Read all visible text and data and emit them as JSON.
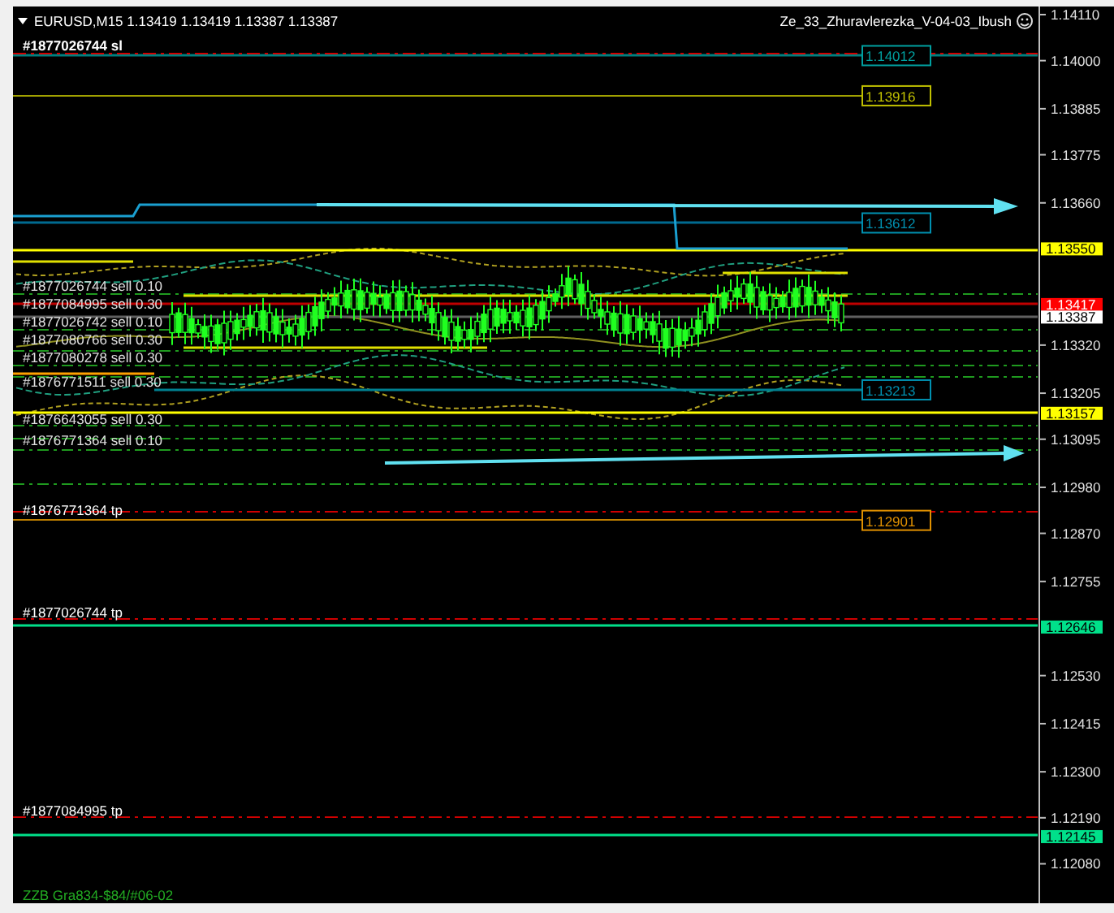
{
  "chart_title": "EURUSD,M15  1.13419 1.13419 1.13387 1.13387",
  "expert_name": "Ze_33_Zhuravlerezka_V-04-03_Ibush",
  "price_axis": {
    "ticks": [
      "1.14110",
      "1.14000",
      "1.13885",
      "1.13775",
      "1.13660",
      "1.13320",
      "1.13205",
      "1.13095",
      "1.12980",
      "1.12870",
      "1.12755",
      "1.12530",
      "1.12415",
      "1.12300",
      "1.12190",
      "1.12080"
    ]
  },
  "axis_tags": [
    {
      "price": "1.13550",
      "color": "#ffff00"
    },
    {
      "price": "1.13417",
      "color": "#ff0000"
    },
    {
      "price": "1.13387",
      "color": "#ffffff"
    },
    {
      "price": "1.13157",
      "color": "#ffff00"
    },
    {
      "price": "1.12646",
      "color": "#00e08a"
    },
    {
      "price": "1.12145",
      "color": "#00e08a"
    }
  ],
  "level_tags": [
    {
      "price": "1.14012",
      "color": "#00a0a0"
    },
    {
      "price": "1.13916",
      "color": "#c0c000"
    },
    {
      "price": "1.13612",
      "color": "#0090b0"
    },
    {
      "price": "1.13213",
      "color": "#0090b0"
    },
    {
      "price": "1.12901",
      "color": "#e09000"
    }
  ],
  "order_labels": [
    {
      "text": "#1877026744 sl",
      "kind": "stop"
    },
    {
      "text": "#1877026744 sell 0.10",
      "kind": "order"
    },
    {
      "text": "#1877084995 sell 0.30",
      "kind": "order"
    },
    {
      "text": "#1877026742 sell 0.10",
      "kind": "order"
    },
    {
      "text": "#1877080766 sell 0.30",
      "kind": "order"
    },
    {
      "text": "#1877080278 sell 0.30",
      "kind": "order"
    },
    {
      "text": "#1876771511 sell 0.30",
      "kind": "order"
    },
    {
      "text": "#1876643055 sell 0.30",
      "kind": "order"
    },
    {
      "text": "#1876771364 sell 0.10",
      "kind": "order"
    },
    {
      "text": "#1876771364 tp",
      "kind": "target"
    },
    {
      "text": "#1877026744 tp",
      "kind": "target"
    },
    {
      "text": "#1877084995 tp",
      "kind": "target"
    }
  ],
  "footer_text": "ZZB Gra834-$84/#06-02"
}
